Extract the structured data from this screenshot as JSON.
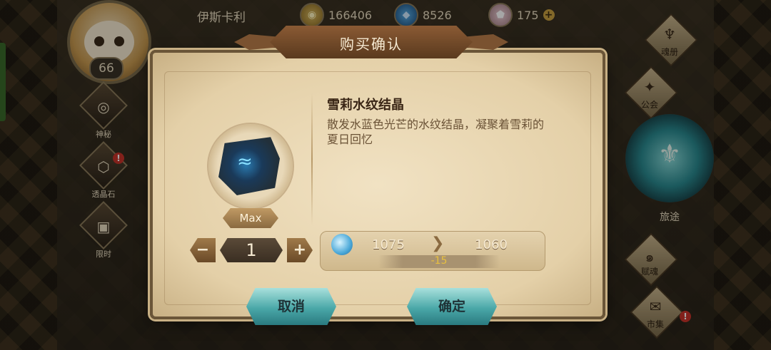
{
  "player": {
    "name": "伊斯卡利",
    "level": "66"
  },
  "resources": [
    {
      "icon": "gold-coin-icon",
      "value": "166406"
    },
    {
      "icon": "blue-gem-icon",
      "value": "8526"
    },
    {
      "icon": "crystal-icon",
      "value": "175"
    }
  ],
  "left_menu": [
    {
      "label": "神秘",
      "glyph": "◎"
    },
    {
      "label": "透晶石",
      "glyph": "⬡",
      "alert": "!"
    },
    {
      "label": "限时",
      "glyph": "▣"
    }
  ],
  "right_menu": {
    "soul_book": "魂册",
    "guild": "公会",
    "journey": "旅途",
    "talent": "赋魂",
    "market": "市集",
    "market_alert": "!"
  },
  "dialog": {
    "title": "购买确认",
    "item_name": "雪莉水纹结晶",
    "item_desc": "散发水蓝色光芒的水纹结晶，凝聚着雪莉的夏日回忆",
    "max_label": "Max",
    "quantity": "1",
    "minus": "−",
    "plus": "+",
    "cost": {
      "from": "1075",
      "to": "1060",
      "diff": "-15"
    },
    "cancel_label": "取消",
    "confirm_label": "确定"
  }
}
